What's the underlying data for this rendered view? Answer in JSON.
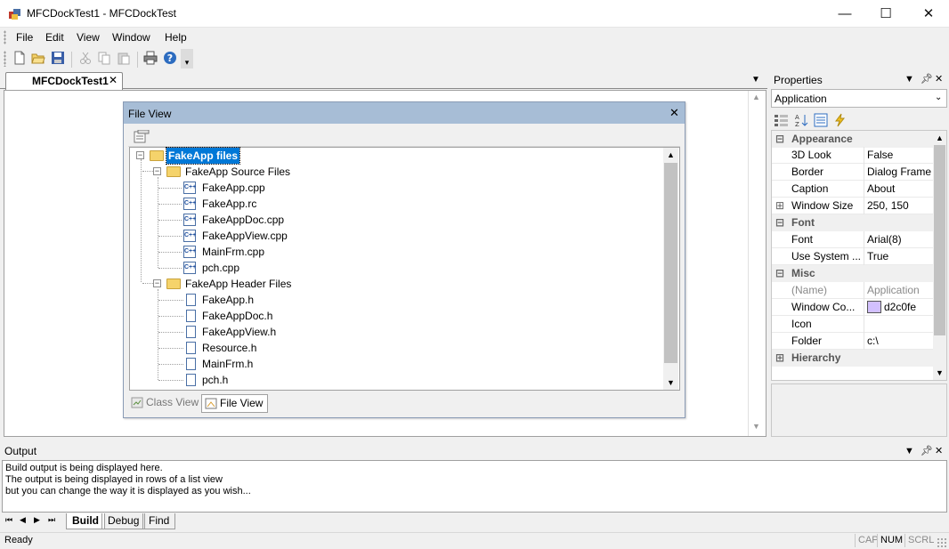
{
  "window": {
    "title": "MFCDockTest1 - MFCDockTest",
    "controls": {
      "minimize": "—",
      "maximize": "☐",
      "close": "✕"
    }
  },
  "menu": [
    "File",
    "Edit",
    "View",
    "Window",
    "Help"
  ],
  "toolbar": {
    "icons": [
      "new-file-icon",
      "open-folder-icon",
      "save-icon",
      "cut-icon",
      "copy-icon",
      "paste-icon",
      "print-icon",
      "help-icon"
    ]
  },
  "document_tab": {
    "label": "MFCDockTest1",
    "close": "✕"
  },
  "file_view": {
    "title": "File View",
    "close": "✕",
    "tree": {
      "root": "FakeApp files",
      "groups": [
        {
          "label": "FakeApp Source Files",
          "items": [
            "FakeApp.cpp",
            "FakeApp.rc",
            "FakeAppDoc.cpp",
            "FakeAppView.cpp",
            "MainFrm.cpp",
            "pch.cpp"
          ]
        },
        {
          "label": "FakeApp Header Files",
          "items": [
            "FakeApp.h",
            "FakeAppDoc.h",
            "FakeAppView.h",
            "Resource.h",
            "MainFrm.h",
            "pch.h"
          ]
        }
      ]
    },
    "tabs": [
      "Class View",
      "File View"
    ],
    "active_tab": "File View"
  },
  "properties": {
    "title": "Properties",
    "combo_value": "Application",
    "categories": {
      "appearance": {
        "label": "Appearance",
        "rows": [
          {
            "name": "3D Look",
            "value": "False"
          },
          {
            "name": "Border",
            "value": "Dialog Frame"
          },
          {
            "name": "Caption",
            "value": "About"
          },
          {
            "name": "Window Size",
            "value": "250, 150",
            "expandable": true
          }
        ]
      },
      "font": {
        "label": "Font",
        "rows": [
          {
            "name": "Font",
            "value": "Arial(8)"
          },
          {
            "name": "Use System ...",
            "value": "True"
          }
        ]
      },
      "misc": {
        "label": "Misc",
        "rows": [
          {
            "name": "(Name)",
            "value": "Application",
            "disabled": true
          },
          {
            "name": "Window Co...",
            "value": "d2c0fe",
            "swatch": "#d2c0fe"
          },
          {
            "name": "Icon",
            "value": ""
          },
          {
            "name": "Folder",
            "value": "c:\\"
          }
        ]
      },
      "hierarchy": {
        "label": "Hierarchy"
      }
    }
  },
  "output": {
    "title": "Output",
    "lines": [
      "Build output is being displayed here.",
      "The output is being displayed in rows of a list view",
      "but you can change the way it is displayed as you wish..."
    ],
    "tabs": [
      "Build",
      "Debug",
      "Find"
    ],
    "active_tab": "Build"
  },
  "status": {
    "text": "Ready",
    "indicators": [
      "CAP",
      "NUM",
      "SCRL"
    ]
  },
  "colors": {
    "accent_selection": "#0078d7",
    "caption_float": "#a7bdd6",
    "swatch": "#d2c0fe"
  }
}
